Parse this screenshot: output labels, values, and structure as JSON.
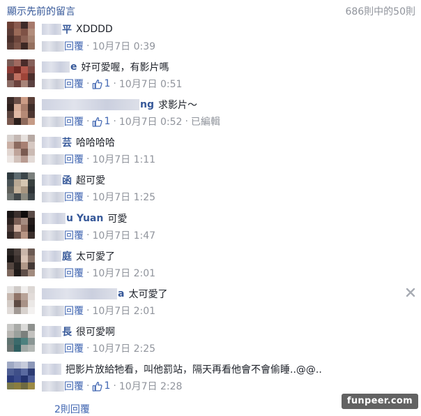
{
  "header": {
    "show_previous": "顯示先前的留言",
    "count": "686則中的50則"
  },
  "comments": [
    {
      "name": "平",
      "text": "XDDDD",
      "reply": "回覆",
      "likes": "",
      "time": "10月7日 0:39",
      "edited": "",
      "avatar": [
        "#6b3f34",
        "#8a5b4f",
        "#3e2a28",
        "#a77a6c",
        "#5c3c36",
        "#9a6a58",
        "#7f5246",
        "#b28d7c",
        "#4a302b",
        "#6d463c",
        "#8c6154",
        "#a48170",
        "#5a3d36",
        "#7b5448",
        "#3c2824",
        "#94705f"
      ]
    },
    {
      "name": "e",
      "text": "好可愛喔，有影片嗎",
      "reply": "回覆",
      "likes": "1",
      "time": "10月7日 0:51",
      "edited": "",
      "avatar": [
        "#7a5b55",
        "#a06a60",
        "#4a2c2a",
        "#86605a",
        "#8d3b35",
        "#6c2823",
        "#b2574b",
        "#7d4a44",
        "#5e3633",
        "#c07061",
        "#9e4438",
        "#4c2e2b",
        "#8b6b64",
        "#6b423d",
        "#a88478",
        "#5a4140"
      ]
    },
    {
      "name": "ng",
      "text": "求影片～",
      "reply": "回覆",
      "likes": "1",
      "time": "10月7日 0:52",
      "edited": "已編輯",
      "avatar": [
        "#3a2a28",
        "#6b4f48",
        "#cc9c86",
        "#5a3f38",
        "#2e201e",
        "#d7ad98",
        "#a87c6a",
        "#3f2d29",
        "#5a433d",
        "#e0b9a5",
        "#b68a76",
        "#4d3631",
        "#78584e",
        "#2b1f1c",
        "#8e6a5c",
        "#c59b86"
      ]
    },
    {
      "name": "芸",
      "text": "哈哈哈哈",
      "reply": "回覆",
      "likes": "",
      "time": "10月7日 1:11",
      "edited": "",
      "avatar": [
        "#d8d2cf",
        "#c4b8b3",
        "#e6e0dd",
        "#b7a9a3",
        "#cab0a5",
        "#8c6b60",
        "#a88073",
        "#d6c8c2",
        "#e1d6d1",
        "#bfa49a",
        "#7a5a50",
        "#cbbab3",
        "#ece6e3",
        "#d2c2bb",
        "#b99c92",
        "#e3dad6"
      ]
    },
    {
      "name": "函",
      "text": "超可愛",
      "reply": "回覆",
      "likes": "",
      "time": "10月7日 1:25",
      "edited": "",
      "avatar": [
        "#2f3a3f",
        "#5c6a6f",
        "#3b4549",
        "#7a7f7c",
        "#4a5356",
        "#b8a894",
        "#d6c7b2",
        "#39403f",
        "#5e5f5a",
        "#c5b39c",
        "#a79580",
        "#2d3336",
        "#6e7370",
        "#42484a",
        "#8b8a80",
        "#3c4447"
      ]
    },
    {
      "name": "u Yuan",
      "text": "可愛",
      "reply": "回覆",
      "likes": "",
      "time": "10月7日 1:47",
      "edited": "",
      "avatar": [
        "#1a1616",
        "#3b2f2d",
        "#0f0c0c",
        "#5a4b47",
        "#2c2220",
        "#7b5f56",
        "#a58b80",
        "#231b1a",
        "#4a3a37",
        "#d5b6a7",
        "#8e6d60",
        "#181313",
        "#2f2523",
        "#6a524a",
        "#b89584",
        "#3a2e2b"
      ]
    },
    {
      "name": "庭",
      "text": "太可愛了",
      "reply": "回覆",
      "likes": "",
      "time": "10月7日 2:01",
      "edited": "",
      "avatar": [
        "#2a2523",
        "#4a3f3b",
        "#c9b6aa",
        "#6b5a53",
        "#191514",
        "#3c322f",
        "#d9c4b6",
        "#8a756a",
        "#544640",
        "#27211f",
        "#b09888",
        "#433835",
        "#7c675d",
        "#1f1a19",
        "#5f4f49",
        "#a18b7e"
      ]
    },
    {
      "name": "a",
      "text": "太可愛了",
      "reply": "回覆",
      "likes": "",
      "time": "10月7日 2:01",
      "edited": "",
      "avatar": [
        "#e7e5e4",
        "#cfcac7",
        "#f1efee",
        "#dcd7d4",
        "#c7b9b0",
        "#8f7468",
        "#b8a398",
        "#e2dcd9",
        "#d3cbc6",
        "#5d4b44",
        "#a89287",
        "#ebe8e6",
        "#e0dbd8",
        "#a29a95",
        "#d8d2ce",
        "#f3f1f0"
      ]
    },
    {
      "name": "長",
      "text": "很可愛啊",
      "reply": "回覆",
      "likes": "",
      "time": "10月7日 2:25",
      "edited": "",
      "avatar": [
        "#c8c8c6",
        "#a9aba8",
        "#dadad8",
        "#8e918e",
        "#b7b5b1",
        "#9aa09c",
        "#7b807d",
        "#c3c2bf",
        "#5f7370",
        "#3b6a6b",
        "#4d817f",
        "#8a9694",
        "#6b7472",
        "#2f5f61",
        "#a1a9a6",
        "#b4b8b5"
      ]
    },
    {
      "name": "",
      "text": "把影片放給牠看，叫他罰站，隔天再看他會不會偷睡..@@..",
      "reply": "回覆",
      "likes": "1",
      "time": "10月7日 2:28",
      "edited": "",
      "avatar": [
        "#9fa9c4",
        "#b5bcd2",
        "#c6cbdb",
        "#8d98b8",
        "#4f5f94",
        "#3f4f88",
        "#5a6aa0",
        "#2c3b73",
        "#2a3a7a",
        "#3a4a8a",
        "#24336e",
        "#4c5c96",
        "#7c7a4a",
        "#8a7d3f",
        "#6f6a40",
        "#9c8a45"
      ]
    }
  ],
  "footer": {
    "replies": "2則回覆"
  },
  "watermark": "funpeer.com"
}
